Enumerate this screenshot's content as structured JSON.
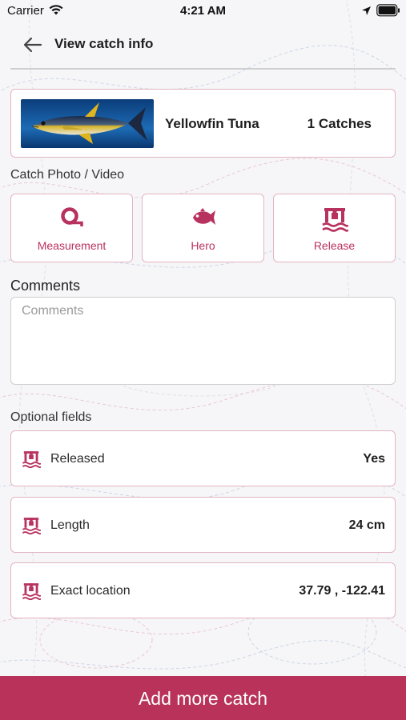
{
  "status_bar": {
    "carrier": "Carrier",
    "time": "4:21 AM"
  },
  "header": {
    "title": "View catch info"
  },
  "species_card": {
    "species_name": "Yellowfin Tuna",
    "catch_count": "1 Catches"
  },
  "media": {
    "section_label": "Catch Photo / Video",
    "tiles": [
      {
        "label": "Measurement",
        "icon": "measuring-tape-icon"
      },
      {
        "label": "Hero",
        "icon": "fish-icon"
      },
      {
        "label": "Release",
        "icon": "release-icon"
      }
    ]
  },
  "comments": {
    "section_label": "Comments",
    "placeholder": "Comments",
    "value": ""
  },
  "optional_fields": {
    "section_label": "Optional fields",
    "rows": [
      {
        "label": "Released",
        "value": "Yes",
        "icon": "release-icon"
      },
      {
        "label": "Length",
        "value": "24 cm",
        "icon": "release-icon"
      },
      {
        "label": "Exact location",
        "value": "37.79 , -122.41",
        "icon": "release-icon"
      }
    ]
  },
  "footer": {
    "add_button_label": "Add more catch"
  },
  "colors": {
    "accent": "#b8325a",
    "card_border": "#e3b4c2",
    "background": "#f6f6f8"
  }
}
